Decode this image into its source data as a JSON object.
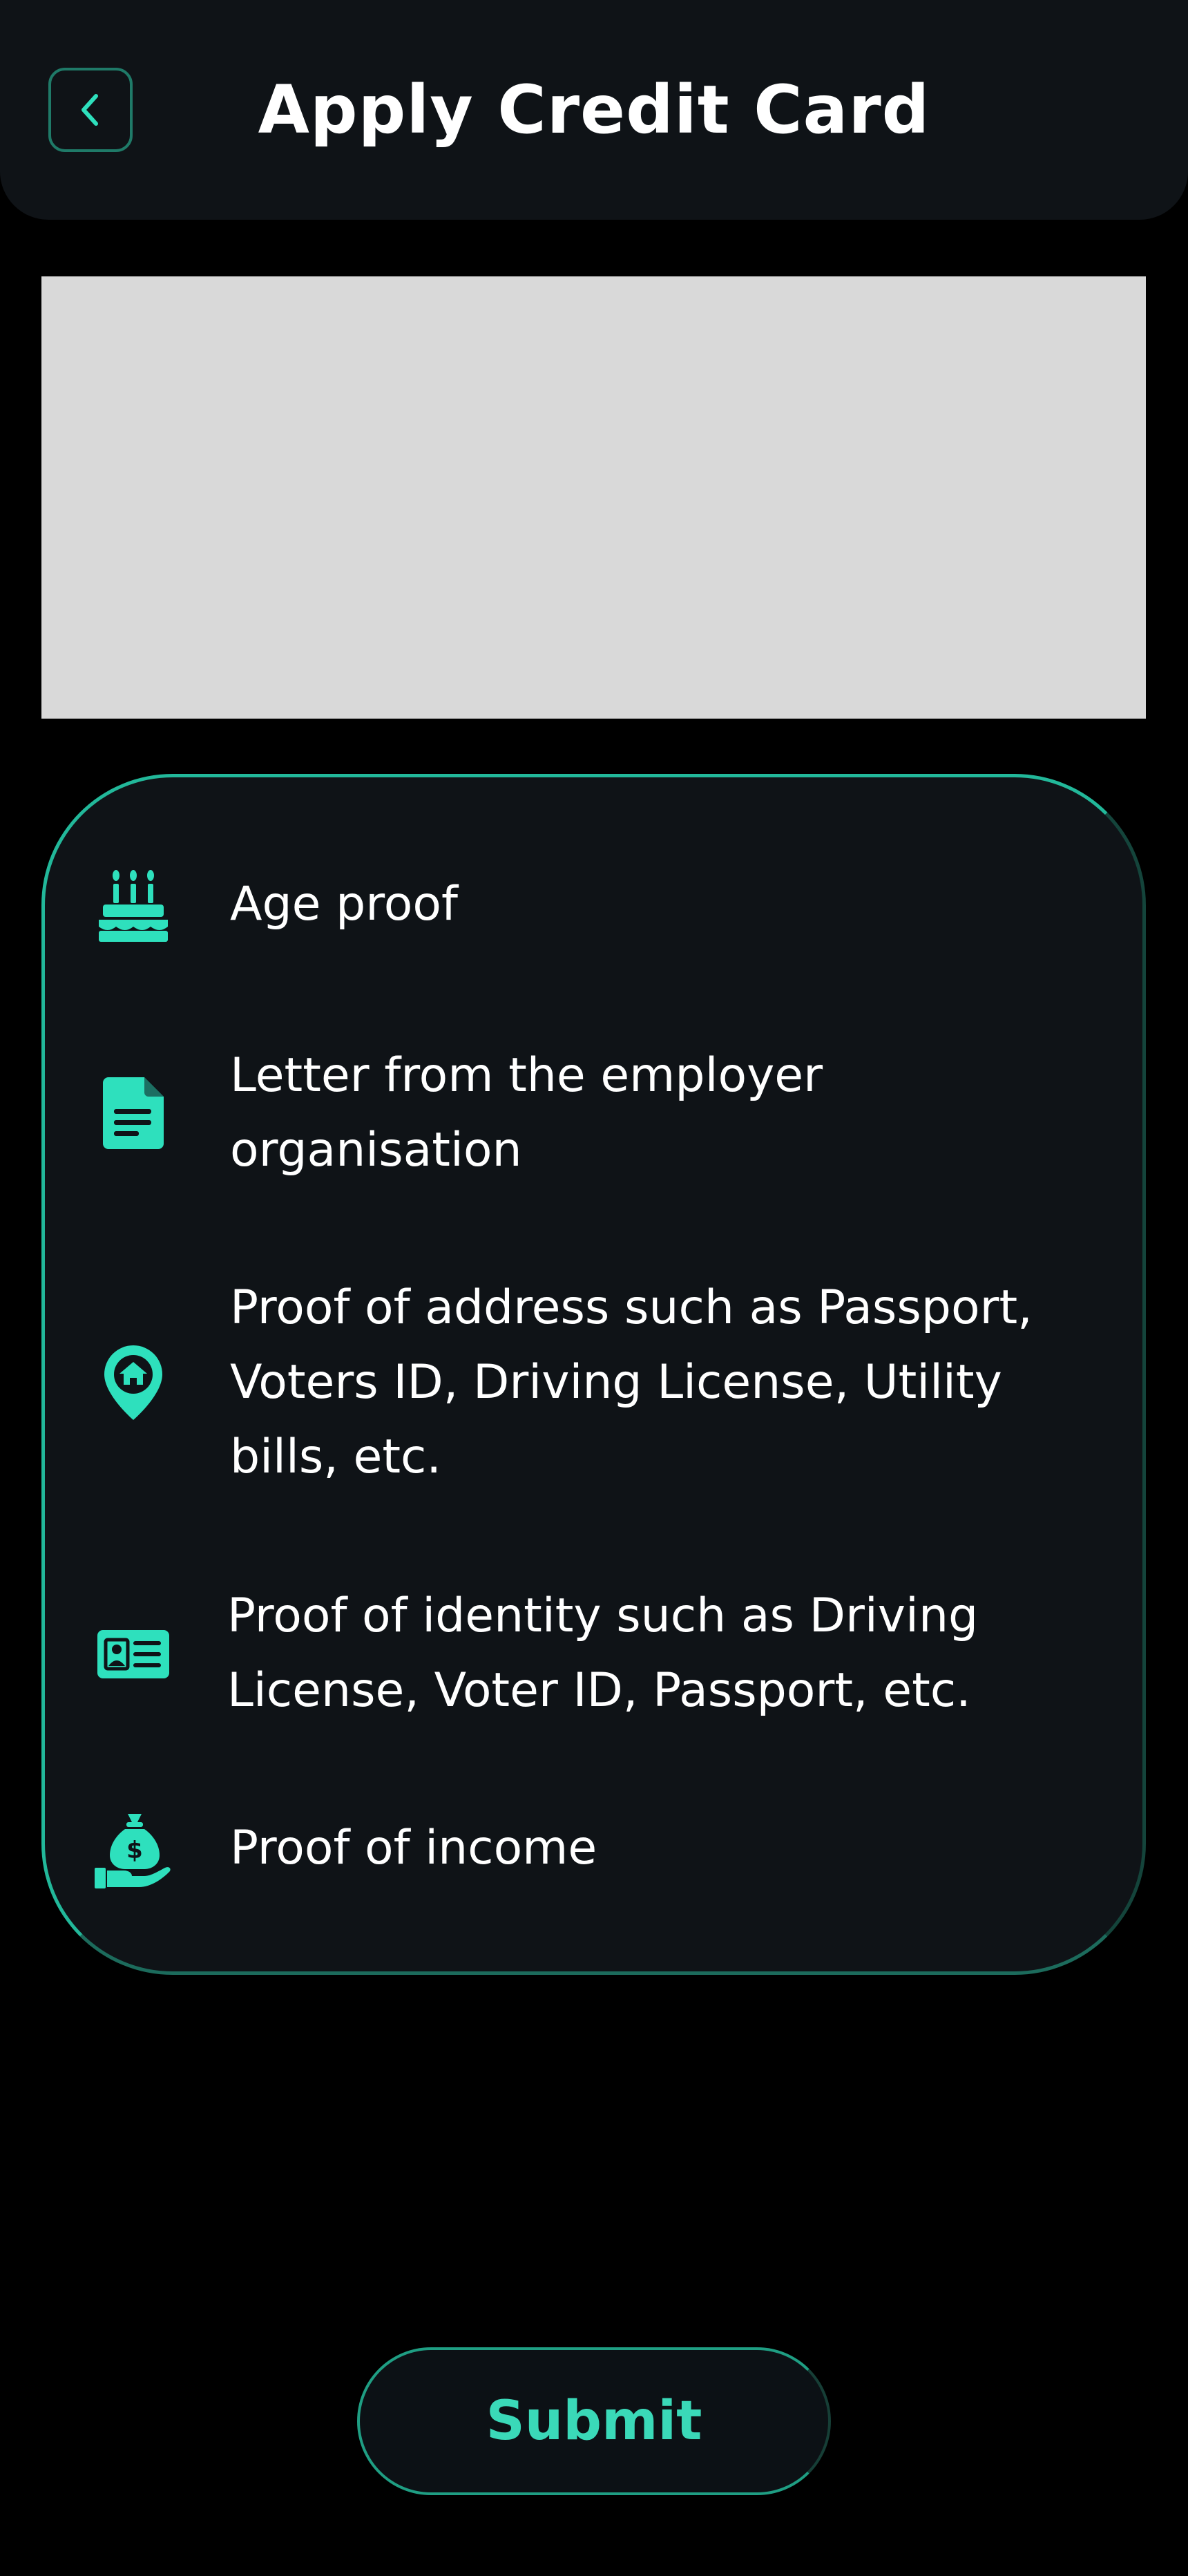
{
  "header": {
    "title": "Apply Credit Card",
    "back_icon": "chevron-left-icon"
  },
  "banner": {
    "color": "#d9d9d9"
  },
  "documents": {
    "items": [
      {
        "icon": "birthday-cake-icon",
        "label": "Age proof"
      },
      {
        "icon": "document-icon",
        "label": "Letter from the employer organisation"
      },
      {
        "icon": "home-location-pin-icon",
        "label": "Proof of address such as Passport, Voters ID, Driving License, Utility bills, etc."
      },
      {
        "icon": "id-card-icon",
        "label": "Proof of identity such as Driving License, Voter ID, Passport, etc."
      },
      {
        "icon": "money-bag-hand-icon",
        "label": "Proof of income"
      }
    ]
  },
  "submit": {
    "label": "Submit"
  },
  "colors": {
    "accent": "#2ee0bd",
    "background": "#000000",
    "surface": "#0f1317"
  }
}
